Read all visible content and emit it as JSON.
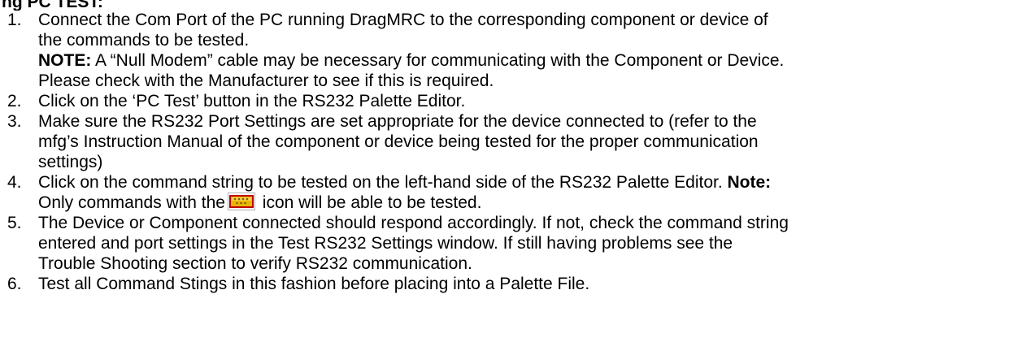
{
  "heading": "ng PC TEST:",
  "icon": "serial-port-icon",
  "colors": {
    "icon_body": "#e8b800",
    "icon_border": "#c00000"
  },
  "steps": [
    {
      "number": "1.",
      "lines": [
        "Connect the Com Port of the PC running DragMRC to the corresponding component or device of",
        "the commands to be tested."
      ],
      "note_label": "NOTE:",
      "note_line1": " A “Null Modem” cable may be necessary for communicating with the Component or Device.",
      "note_line2": "Please check with the Manufacturer to see if this is required."
    },
    {
      "number": "2.",
      "lines": [
        "Click on the ‘PC Test’ button in the RS232 Palette Editor."
      ]
    },
    {
      "number": "3.",
      "lines": [
        "Make sure the RS232 Port Settings are set appropriate for the device connected to (refer to the",
        "mfg’s Instruction Manual of the component or device being tested for the proper communication",
        "settings)"
      ]
    },
    {
      "number": "4.",
      "line1": "Click on the command string to be tested on the left-hand side of the RS232 Palette Editor. ",
      "note_label": "Note:",
      "line2_before": "Only commands with the",
      "line2_after": " icon will be able to be tested."
    },
    {
      "number": "5.",
      "lines": [
        "The Device or Component connected should respond accordingly. If not, check the command string",
        "entered and port settings in the Test RS232 Settings window. If still having problems see the",
        "Trouble Shooting section to verify RS232 communication."
      ]
    },
    {
      "number": "6.",
      "lines": [
        "Test all Command Stings in this fashion before placing into a Palette File."
      ]
    }
  ]
}
